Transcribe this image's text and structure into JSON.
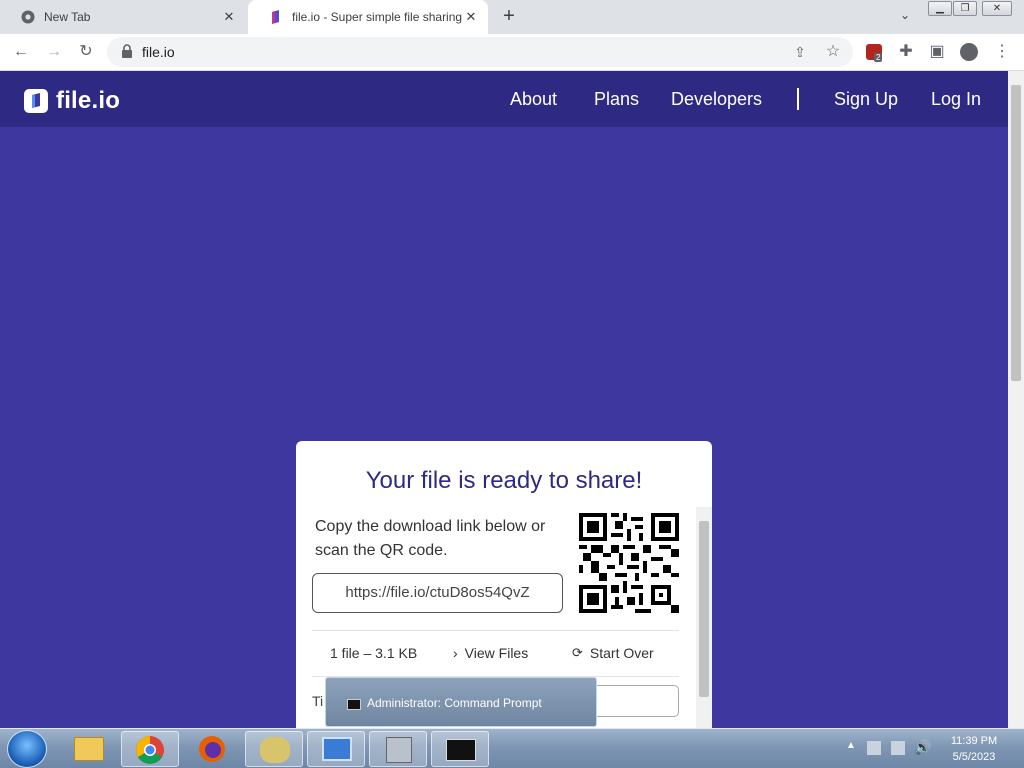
{
  "browser": {
    "tabs": [
      {
        "title": "New Tab"
      },
      {
        "title": "file.io - Super simple file sharing"
      }
    ],
    "url": "file.io",
    "extension_badge": "2"
  },
  "site": {
    "logo": "file.io",
    "nav": {
      "about": "About",
      "plans": "Plans",
      "developers": "Developers",
      "signup": "Sign Up",
      "login": "Log In"
    }
  },
  "card": {
    "title": "Your file is ready to share!",
    "description": "Copy the download link below or scan the QR code.",
    "link": "https://file.io/ctuD8os54QvZ",
    "file_info": "1 file – 3.1 KB",
    "view_files": "View Files",
    "start_over": "Start Over",
    "partial_label": "Ti"
  },
  "taskbar": {
    "popup_title": "Administrator:  Command Prompt",
    "time": "11:39 PM",
    "date": "5/5/2023"
  },
  "colors": {
    "page_bg": "#3f37a0",
    "nav_bg": "#2e2a84",
    "accent": "#2e2a84"
  }
}
